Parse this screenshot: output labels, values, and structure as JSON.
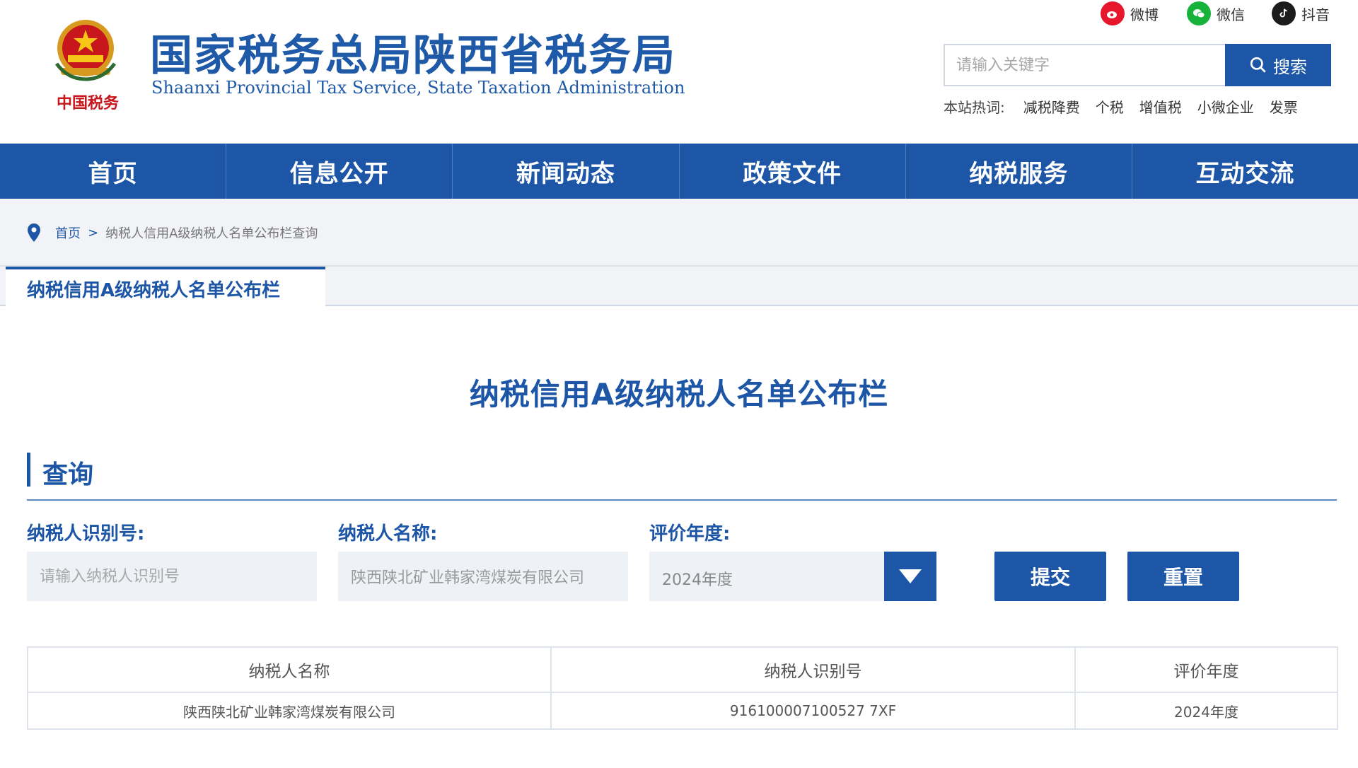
{
  "header": {
    "emblem_text": "中国税务",
    "title": "国家税务总局陕西省税务局",
    "subtitle": "Shaanxi Provincial Tax Service, State Taxation Administration"
  },
  "social": {
    "weibo": {
      "label": "微博",
      "icon": "weibo-icon"
    },
    "wechat": {
      "label": "微信",
      "icon": "wechat-icon"
    },
    "douyin": {
      "label": "抖音",
      "icon": "douyin-icon"
    }
  },
  "search": {
    "placeholder": "请输入关键字",
    "button_label": "搜索"
  },
  "hot": {
    "label": "本站热词:",
    "words": [
      "减税降费",
      "个税",
      "增值税",
      "小微企业",
      "发票"
    ]
  },
  "nav": [
    "首页",
    "信息公开",
    "新闻动态",
    "政策文件",
    "纳税服务",
    "互动交流"
  ],
  "breadcrumb": {
    "home": "首页",
    "separator": ">",
    "current": "纳税人信用A级纳税人名单公布栏查询"
  },
  "tab": {
    "active_label": "纳税信用A级纳税人名单公布栏"
  },
  "content": {
    "page_title": "纳税信用A级纳税人名单公布栏",
    "section_label": "查询"
  },
  "form": {
    "id_label": "纳税人识别号:",
    "id_placeholder": "请输入纳税人识别号",
    "name_label": "纳税人名称:",
    "name_value": "陕西陕北矿业韩家湾煤炭有限公司",
    "year_label": "评价年度:",
    "year_value": "2024年度",
    "submit_label": "提交",
    "reset_label": "重置"
  },
  "table": {
    "headers": [
      "纳税人名称",
      "纳税人识别号",
      "评价年度"
    ],
    "rows": [
      [
        "陕西陕北矿业韩家湾煤炭有限公司",
        "916100007100527 7XF",
        "2024年度"
      ]
    ]
  },
  "colors": {
    "brand_blue": "#1d56a6",
    "weibo_red": "#e6162d",
    "wechat_green": "#17b23a"
  }
}
